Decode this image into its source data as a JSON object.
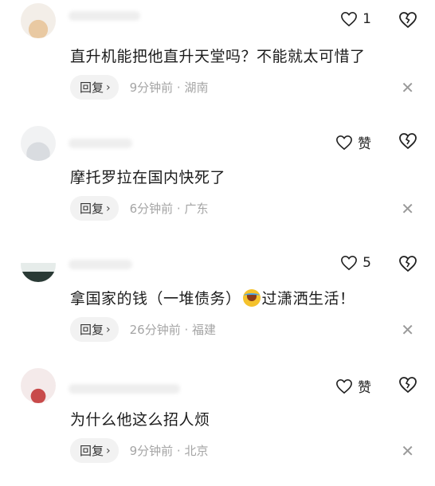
{
  "comments": [
    {
      "like_label": "1",
      "text": "直升机能把他直升天堂吗？不能就太可惜了",
      "reply_label": "回复",
      "time": "9分钟前 · 湖南"
    },
    {
      "like_label": "赞",
      "text": "摩托罗拉在国内快死了",
      "reply_label": "回复",
      "time": "6分钟前 · 广东"
    },
    {
      "like_label": "5",
      "text_before": "拿国家的钱（一堆债务）",
      "text_after": "过潇洒生活！",
      "reply_label": "回复",
      "time": "26分钟前 · 福建"
    },
    {
      "like_label": "赞",
      "text": "为什么他这么招人烦",
      "reply_label": "回复",
      "time": "9分钟前 · 北京"
    }
  ],
  "icons": {
    "like": "heart-icon",
    "dislike": "broken-heart-icon",
    "dismiss": "close-icon",
    "reply_chevron": "chevron-right-icon",
    "laugh_emoji": "laughing-crying-emoji"
  },
  "colors": {
    "background": "#ffffff",
    "text": "#1c1c1c",
    "meta": "#a5a5a5",
    "reply_bg": "#f2f2f2"
  }
}
